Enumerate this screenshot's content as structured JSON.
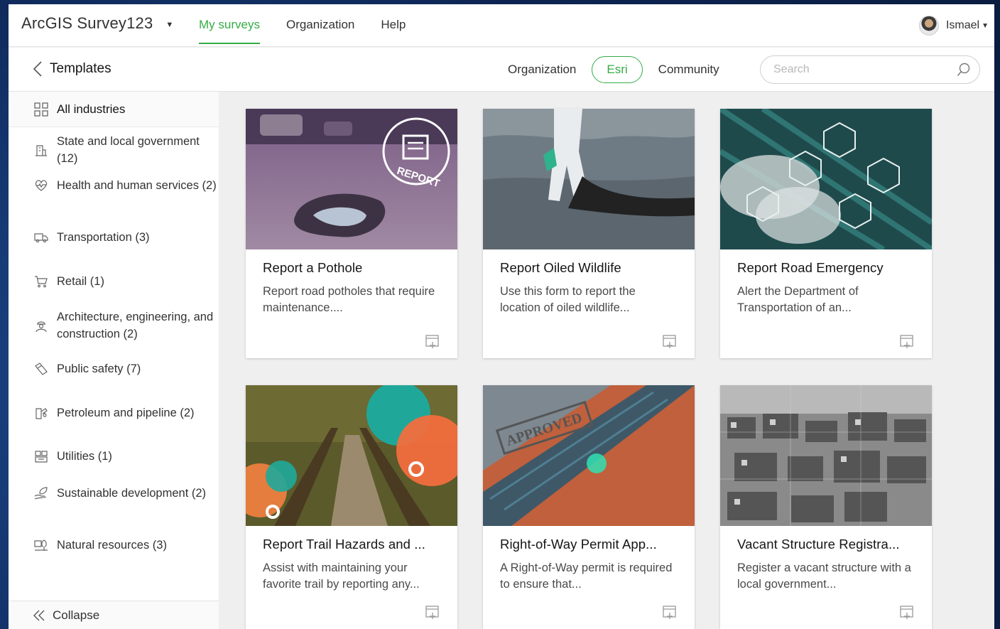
{
  "app": {
    "brand": "ArcGIS Survey123",
    "nav": [
      "My surveys",
      "Organization",
      "Help"
    ],
    "active_nav": "My surveys",
    "user": "Ismael"
  },
  "subheader": {
    "back_label": "Templates",
    "filters": [
      "Organization",
      "Esri",
      "Community"
    ],
    "active_filter": "Esri",
    "search_placeholder": "Search"
  },
  "sidebar": {
    "all_label": "All industries",
    "items": [
      {
        "label": "State and local government (12)",
        "icon": "building-icon"
      },
      {
        "label": "Health and human services (2)",
        "icon": "heart-pulse-icon"
      },
      {
        "label": "Transportation (3)",
        "icon": "truck-icon"
      },
      {
        "label": "Retail (1)",
        "icon": "cart-icon"
      },
      {
        "label": "Architecture, engineering, and construction (2)",
        "icon": "worker-icon"
      },
      {
        "label": "Public safety (7)",
        "icon": "shield-icon"
      },
      {
        "label": "Petroleum and pipeline (2)",
        "icon": "oil-drop-icon"
      },
      {
        "label": "Utilities (1)",
        "icon": "utility-pole-icon"
      },
      {
        "label": "Sustainable development (2)",
        "icon": "leaf-hand-icon"
      },
      {
        "label": "Natural resources (3)",
        "icon": "tree-icon"
      }
    ],
    "collapse_label": "Collapse"
  },
  "cards": [
    {
      "title": "Report a Pothole",
      "desc": "Report road potholes that require maintenance....",
      "thumb_text": "REPORT"
    },
    {
      "title": "Report Oiled Wildlife",
      "desc": "Use this form to report the location of oiled wildlife..."
    },
    {
      "title": "Report Road Emergency",
      "desc": "Alert the Department of Transportation of an..."
    },
    {
      "title": "Report Trail Hazards and ...",
      "desc": "Assist with maintaining your favorite trail by reporting any..."
    },
    {
      "title": "Right-of-Way Permit App...",
      "desc": "A Right-of-Way permit is required to ensure that...",
      "thumb_text": "APPROVED"
    },
    {
      "title": "Vacant Structure Registra...",
      "desc": "Register a vacant structure with a local government..."
    }
  ],
  "colors": {
    "accent": "#35ac46",
    "bg": "#efefef"
  }
}
